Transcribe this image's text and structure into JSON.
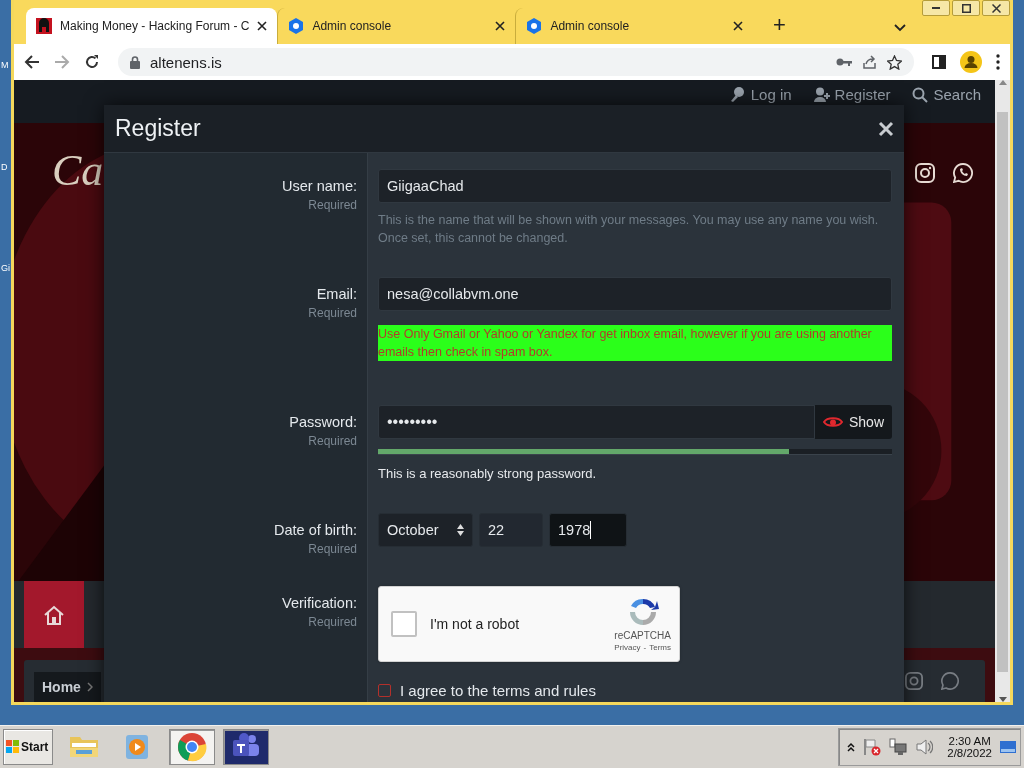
{
  "desktop": {
    "icon_labels": [
      {
        "text": "M"
      },
      {
        "text": "D"
      },
      {
        "text": "Gi"
      }
    ]
  },
  "browser": {
    "tabs": [
      {
        "title": "Making Money - Hacking Forum - C",
        "kind": "forum",
        "selected": true
      },
      {
        "title": "Admin console",
        "kind": "admin",
        "selected": false
      },
      {
        "title": "Admin console",
        "kind": "admin",
        "selected": false
      }
    ],
    "new_tab": "+",
    "address": "altenens.is"
  },
  "page": {
    "nav": [
      {
        "label": "Log in"
      },
      {
        "label": "Register"
      },
      {
        "label": "Search"
      }
    ],
    "logo": "Ca",
    "breadcrumb": "Home"
  },
  "modal": {
    "title": "Register",
    "fields": [
      {
        "kind": "text",
        "label": "User name:",
        "required": "Required",
        "value": "GiigaaChad",
        "hint": [
          "This is the name that will be shown with your messages. You may use any name you wish.",
          "Once set, this cannot be changed."
        ]
      },
      {
        "kind": "email",
        "label": "Email:",
        "required": "Required",
        "value": "nesa@collabvm.one",
        "notice": "Use Only Gmail or Yahoo or Yandex for get inbox email, however if you are using another emails then check in spam box."
      },
      {
        "kind": "password",
        "label": "Password:",
        "required": "Required",
        "value": "•••••••••",
        "toggle": "Show",
        "level": 0.8,
        "strength_text": "This is a reasonably strong password."
      },
      {
        "kind": "date",
        "label": "Date of birth:",
        "required": "Required",
        "month": "October",
        "day": "22",
        "year": "1978",
        "year_focused": true
      },
      {
        "kind": "captcha",
        "label": "Verification:",
        "required": "Required",
        "checkbox_label": "I'm not a robot",
        "checked": false,
        "brand": "reCAPTCHA",
        "privacy": "Privacy",
        "separator": "-",
        "terms": "Terms"
      }
    ],
    "terms": {
      "label": "I agree to the terms and rules",
      "checked": false
    }
  },
  "taskbar": {
    "start": "Start",
    "apps": [
      {
        "kind": "explorer",
        "active": false
      },
      {
        "kind": "media",
        "active": false
      },
      {
        "kind": "chrome",
        "active": true
      },
      {
        "kind": "teams",
        "active": true
      }
    ],
    "time": "2:30 AM",
    "date": "2/8/2022"
  }
}
